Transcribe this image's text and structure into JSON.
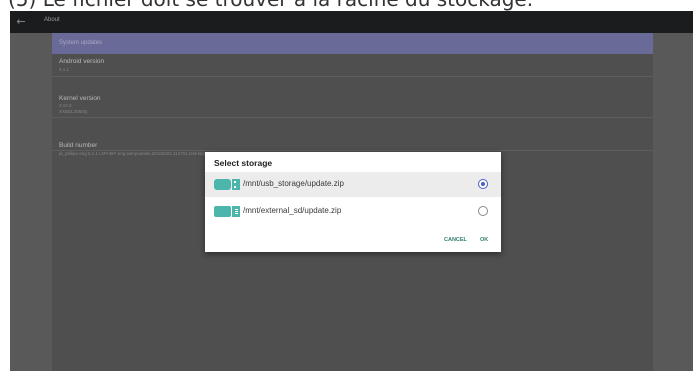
{
  "caption": {
    "text": "(5) Le fichier doit se trouver à la racine du stockage."
  },
  "appbar": {
    "title": "About",
    "back_icon": "arrow-left-icon"
  },
  "settings": {
    "highlighted": {
      "label": "System updates"
    },
    "items": [
      {
        "title": "Android version",
        "summary": "5.1.1"
      },
      {
        "title": "Kernel version",
        "summary": "3.10.0",
        "summary2": "XXBDL3050Q"
      },
      {
        "title": "Build number",
        "summary": "pl_philips-eng 5.1.1 LMY48Y eng.wenyuanlan.20160322.114701 test-keys FB01.01"
      }
    ]
  },
  "dialog": {
    "title": "Select storage",
    "options": [
      {
        "label": "/mnt/usb_storage/update.zip",
        "icon": "usb-storage-icon",
        "selected": true
      },
      {
        "label": "/mnt/external_sd/update.zip",
        "icon": "sd-card-icon",
        "selected": false
      }
    ],
    "cancel_label": "CANCEL",
    "ok_label": "OK"
  },
  "colors": {
    "accent": "#4a5fc4",
    "icon_teal": "#4db6ac",
    "button_text": "#2e7d6a",
    "highlight": "#6a6a98"
  }
}
